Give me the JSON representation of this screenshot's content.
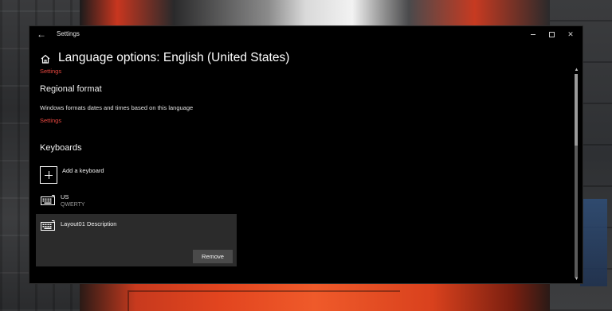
{
  "window": {
    "title": "Settings",
    "back_glyph": "←"
  },
  "page": {
    "title": "Language options: English (United States)",
    "top_link": "Settings"
  },
  "regional_format": {
    "heading": "Regional format",
    "description": "Windows formats dates and times based on this language",
    "link": "Settings"
  },
  "keyboards": {
    "heading": "Keyboards",
    "add_label": "Add a keyboard",
    "items": [
      {
        "name": "US",
        "layout": "QWERTY"
      },
      {
        "name": "Layout01 Description",
        "layout": "",
        "remove_label": "Remove"
      }
    ]
  },
  "colors": {
    "accent_link": "#e94840",
    "window_bg": "#000000",
    "selected_item_bg": "#2b2b2b"
  },
  "icons": [
    "back-arrow-icon",
    "minimize-icon",
    "maximize-icon",
    "close-icon",
    "home-icon",
    "plus-icon",
    "keyboard-icon"
  ]
}
